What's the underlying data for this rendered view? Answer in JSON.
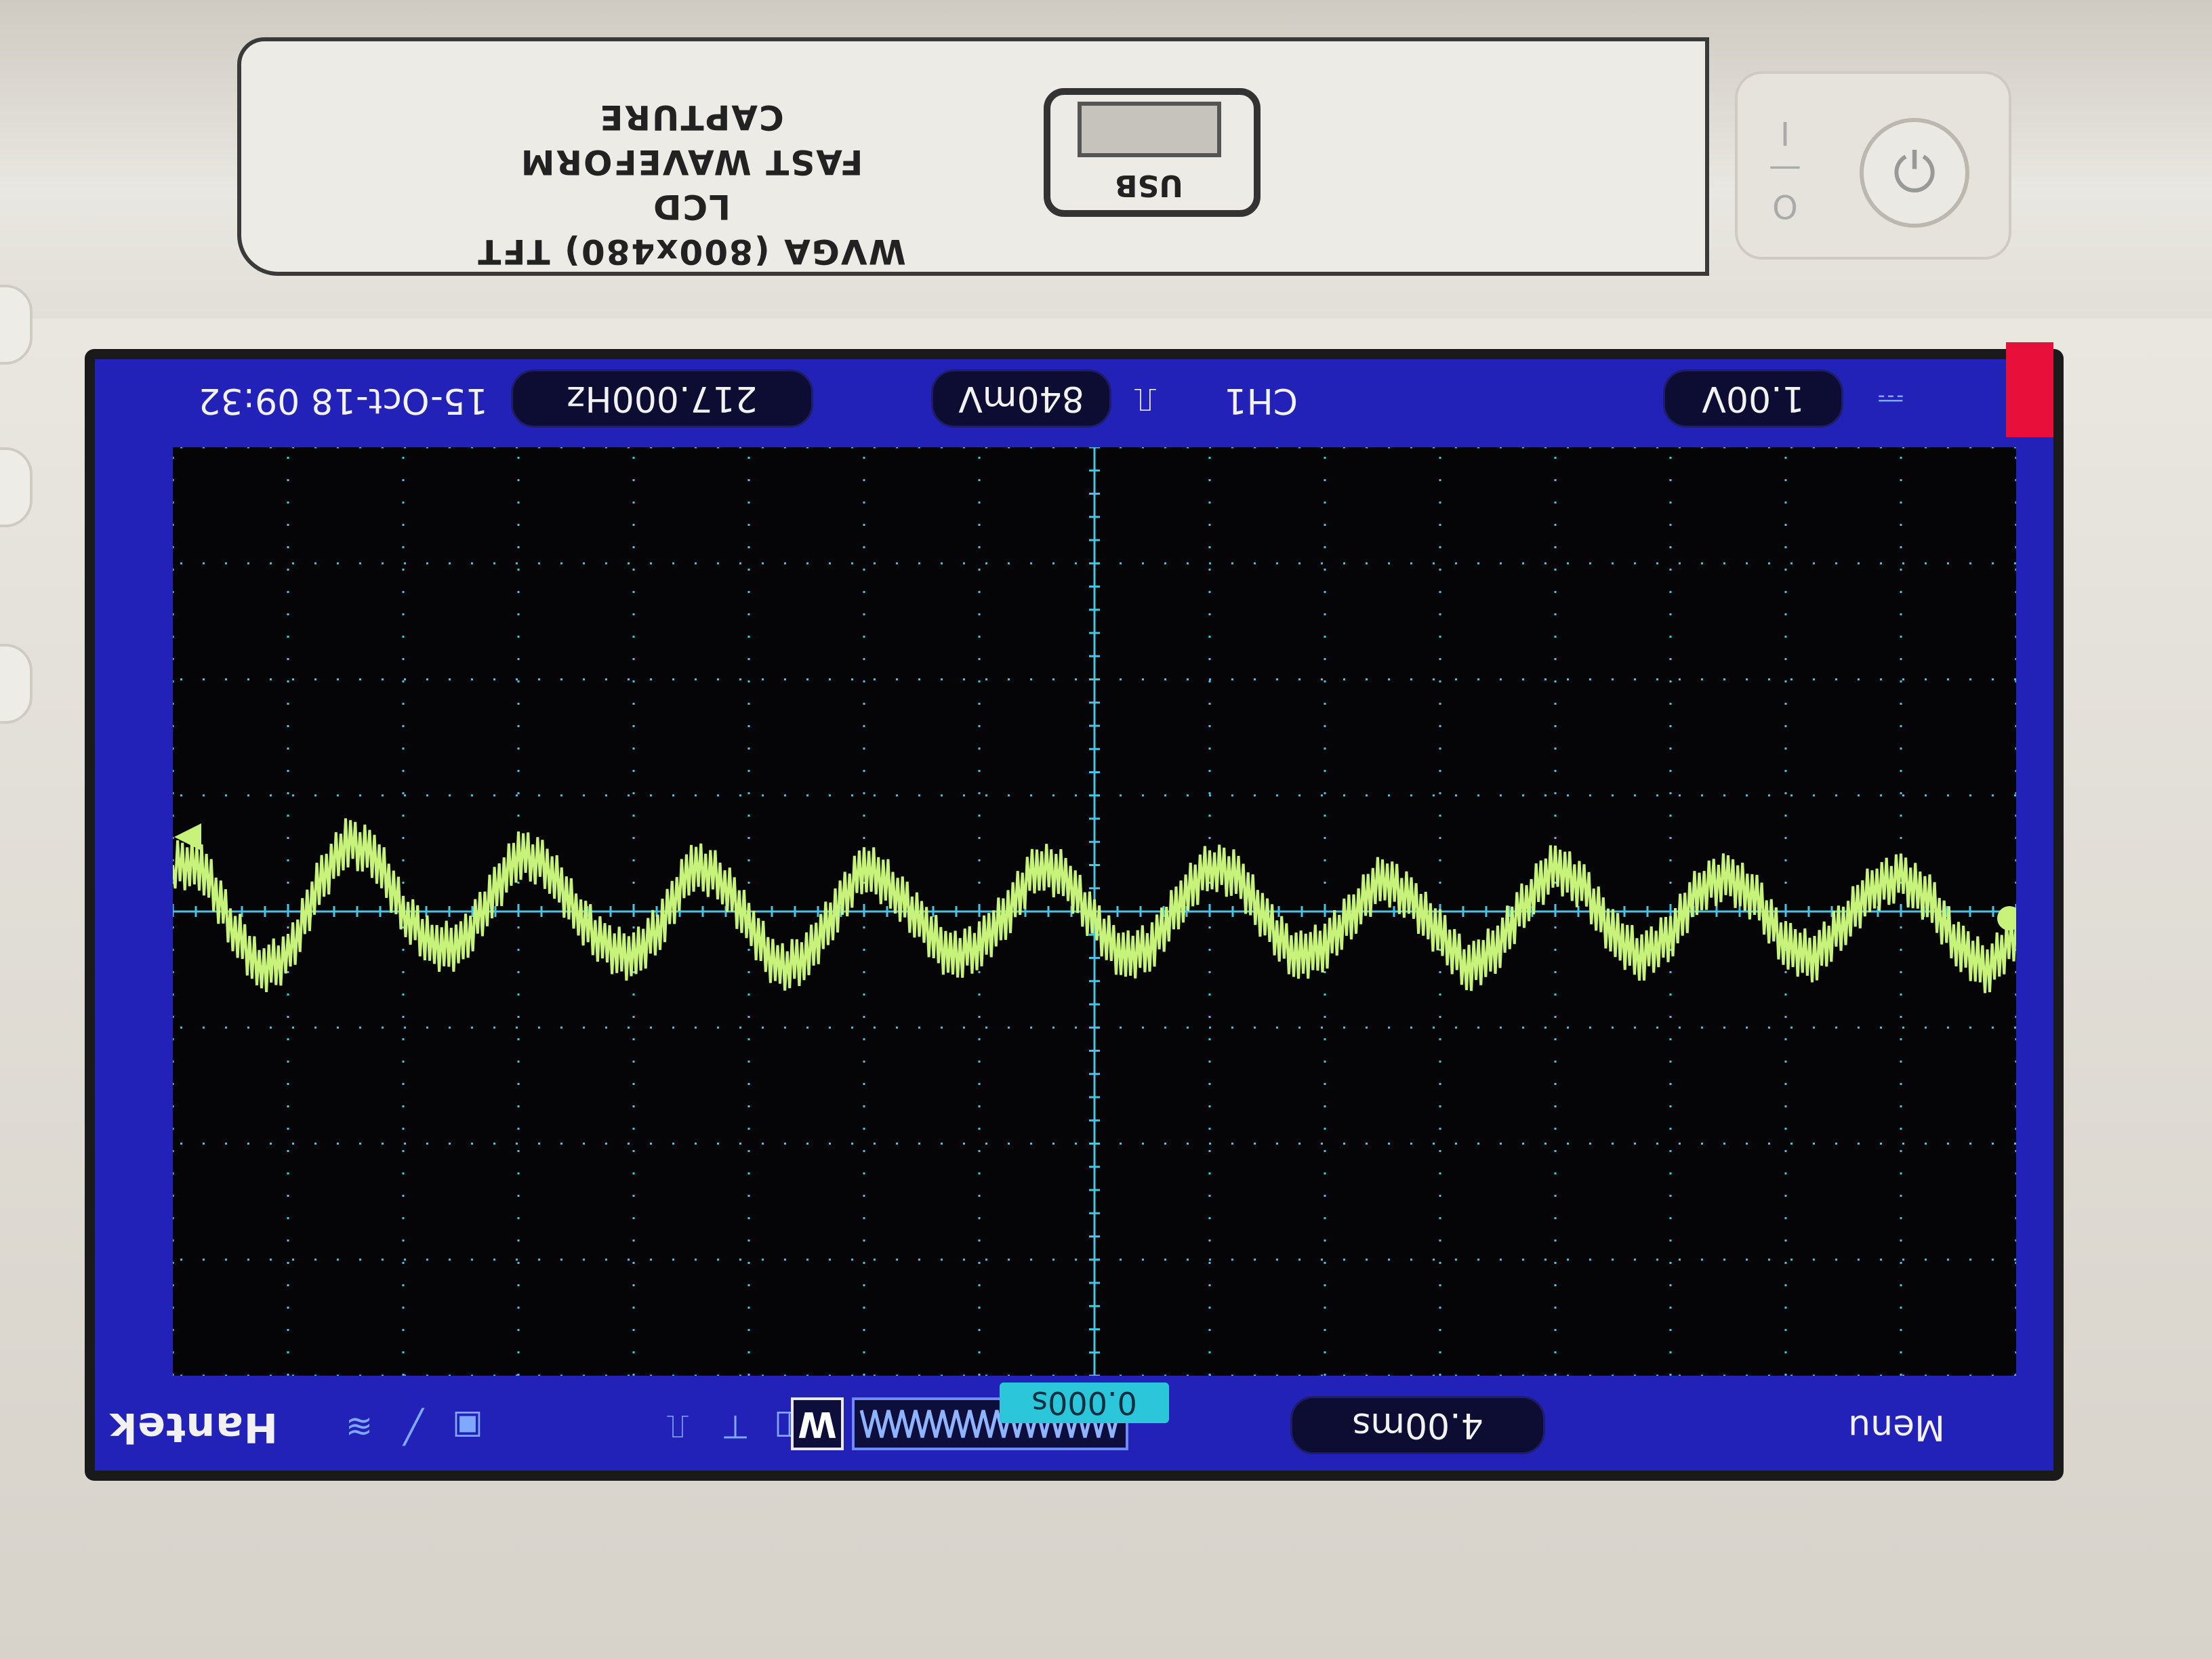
{
  "device": {
    "label_line1": "WVGA (800x480) TFT LCD",
    "label_line2": "FAST WAVEFORM CAPTURE",
    "usb_label": "USB",
    "power_label": "O—I"
  },
  "screen": {
    "top_bar": {
      "timestamp": "15-Oct-18 09:32",
      "frequency": "217.000Hz",
      "trigger_level": "840mV",
      "trigger_channel": "CH1",
      "channel_scale": "1.00V"
    },
    "bottom_bar": {
      "menu_label": "Menu",
      "timebase": "4.00ms",
      "waveform_mode_label": "W",
      "brand": "Hantek"
    },
    "trigger_position": "0.000s"
  },
  "colors": {
    "screen_border": "#2322b8",
    "plot_background": "#050507",
    "grid": "#46c6e6",
    "trace": "#c8f37a",
    "marker": "#e8103a"
  },
  "chart_data": {
    "type": "line",
    "title": "",
    "xlabel": "",
    "ylabel": "",
    "x_divisions": 16,
    "y_divisions": 8,
    "time_per_div": "4.00ms",
    "volts_per_div": "1.00V",
    "grid": true,
    "series": [
      {
        "name": "CH1",
        "x": [
          0,
          0.25,
          0.5,
          0.75,
          1,
          1.25,
          1.5,
          1.75,
          2,
          2.25,
          2.5,
          2.75,
          3,
          3.25,
          3.5,
          3.75,
          4,
          4.25,
          4.5,
          4.75,
          5,
          5.25,
          5.5,
          5.75,
          6,
          6.25,
          6.5,
          6.75,
          7,
          7.25,
          7.5,
          7.75,
          8,
          8.25,
          8.5,
          8.75,
          9,
          9.25,
          9.5,
          9.75,
          10,
          10.25,
          10.5,
          10.75,
          11,
          11.25,
          11.5,
          11.75,
          12,
          12.25,
          12.5,
          12.75,
          13,
          13.25,
          13.5,
          13.75,
          14,
          14.25,
          14.5,
          14.75,
          15,
          15.25,
          15.5,
          15.75,
          16
        ],
        "y": [
          0.2,
          0.5,
          0.3,
          -0.1,
          -0.3,
          -0.2,
          0.1,
          0.4,
          0.3,
          -0.1,
          -0.3,
          -0.2,
          0.2,
          0.4,
          0.2,
          -0.2,
          -0.4,
          -0.1,
          0.3,
          0.5,
          0.2,
          -0.1,
          -0.3,
          0.0,
          0.3,
          0.4,
          0.1,
          -0.3,
          -0.4,
          -0.1,
          0.3,
          0.4,
          0.1,
          -0.3,
          -0.4,
          0.0,
          0.3,
          0.4,
          0.1,
          -0.2,
          -0.4,
          0.0,
          0.4,
          0.5,
          0.1,
          -0.3,
          -0.4,
          0.1,
          0.4,
          0.3,
          0.0,
          -0.4,
          -0.5,
          -0.1,
          0.3,
          0.3,
          0.0,
          -0.5,
          -0.6,
          -0.2,
          0.4,
          0.5,
          0.1,
          -0.4,
          -0.4
        ]
      }
    ]
  }
}
